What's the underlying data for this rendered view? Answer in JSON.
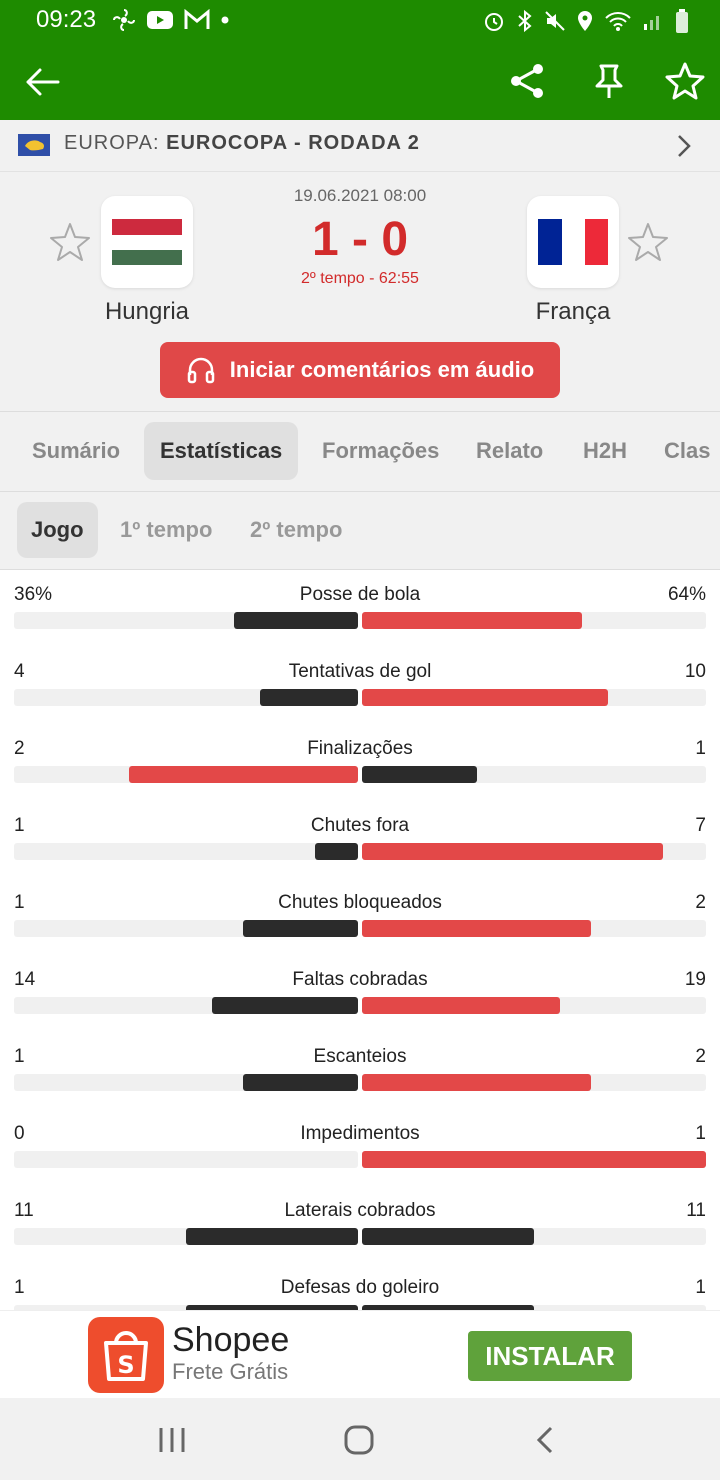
{
  "status_bar": {
    "time": "09:23"
  },
  "league": {
    "region": "EUROPA:",
    "competition": "EUROCOPA - RODADA 2"
  },
  "match": {
    "date": "19.06.2021 08:00",
    "score": "1 - 0",
    "period": "2º tempo - 62:55",
    "home": {
      "name": "Hungria",
      "flag_colors": [
        "#cd2a3e",
        "#ffffff",
        "#436f4d"
      ]
    },
    "away": {
      "name": "França",
      "flag_colors": [
        "#002395",
        "#ffffff",
        "#ed2939"
      ]
    },
    "audio_button": "Iniciar comentários em áudio"
  },
  "tabs": [
    {
      "label": "Sumário",
      "active": false
    },
    {
      "label": "Estatísticas",
      "active": true
    },
    {
      "label": "Formações",
      "active": false
    },
    {
      "label": "Relato",
      "active": false
    },
    {
      "label": "H2H",
      "active": false
    },
    {
      "label": "Clas",
      "active": false
    }
  ],
  "subtabs": [
    {
      "label": "Jogo",
      "active": true
    },
    {
      "label": "1º tempo",
      "active": false
    },
    {
      "label": "2º tempo",
      "active": false
    }
  ],
  "colors": {
    "leader": "#e34848",
    "trailer": "#2b2b2b",
    "brand": "#1e8b00"
  },
  "stats": [
    {
      "name": "Posse de bola",
      "home": "36%",
      "away": "64%",
      "home_val": 36,
      "away_val": 64,
      "home_frac": 0.36,
      "away_frac": 0.64
    },
    {
      "name": "Tentativas de gol",
      "home": "4",
      "away": "10",
      "home_val": 4,
      "away_val": 10,
      "home_frac": 0.286,
      "away_frac": 0.714
    },
    {
      "name": "Finalizações",
      "home": "2",
      "away": "1",
      "home_val": 2,
      "away_val": 1,
      "home_frac": 0.667,
      "away_frac": 0.333
    },
    {
      "name": "Chutes fora",
      "home": "1",
      "away": "7",
      "home_val": 1,
      "away_val": 7,
      "home_frac": 0.125,
      "away_frac": 0.875
    },
    {
      "name": "Chutes bloqueados",
      "home": "1",
      "away": "2",
      "home_val": 1,
      "away_val": 2,
      "home_frac": 0.333,
      "away_frac": 0.667
    },
    {
      "name": "Faltas cobradas",
      "home": "14",
      "away": "19",
      "home_val": 14,
      "away_val": 19,
      "home_frac": 0.424,
      "away_frac": 0.576
    },
    {
      "name": "Escanteios",
      "home": "1",
      "away": "2",
      "home_val": 1,
      "away_val": 2,
      "home_frac": 0.333,
      "away_frac": 0.667
    },
    {
      "name": "Impedimentos",
      "home": "0",
      "away": "1",
      "home_val": 0,
      "away_val": 1,
      "home_frac": 0,
      "away_frac": 1
    },
    {
      "name": "Laterais cobrados",
      "home": "11",
      "away": "11",
      "home_val": 11,
      "away_val": 11,
      "home_frac": 0.5,
      "away_frac": 0.5
    },
    {
      "name": "Defesas do goleiro",
      "home": "1",
      "away": "1",
      "home_val": 1,
      "away_val": 1,
      "home_frac": 0.5,
      "away_frac": 0.5
    }
  ],
  "ad": {
    "title": "Shopee",
    "subtitle": "Frete Grátis",
    "install": "INSTALAR"
  }
}
